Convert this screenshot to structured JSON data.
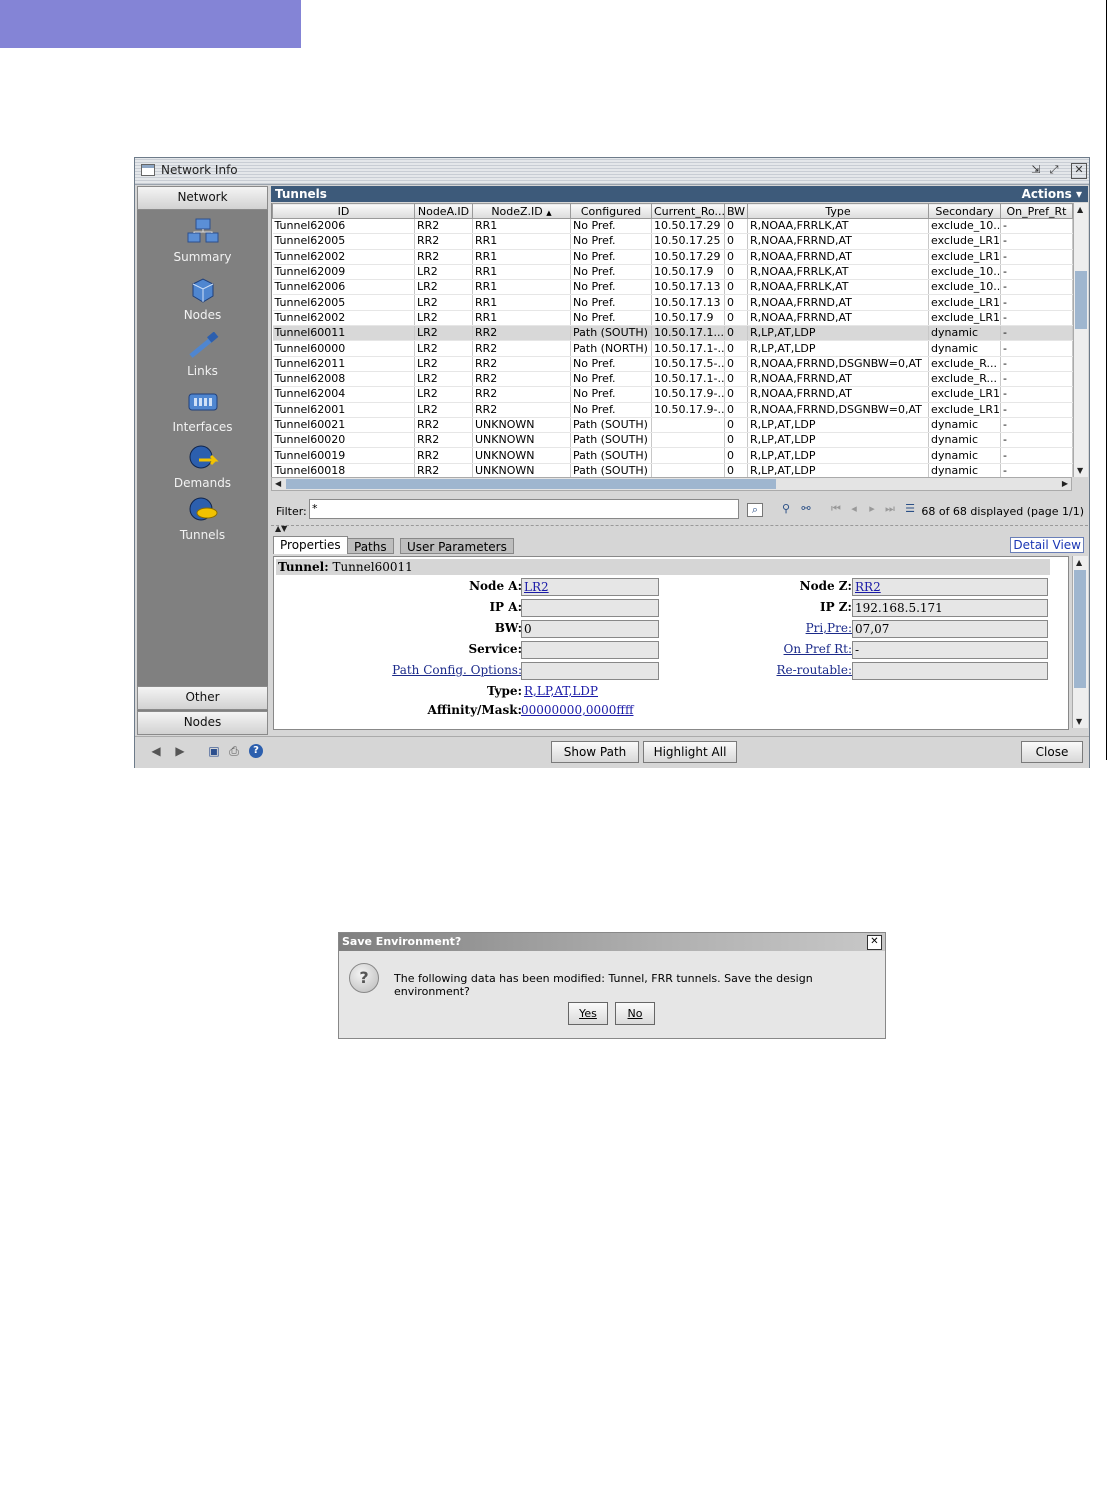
{
  "window": {
    "title": "Network Info"
  },
  "nav": {
    "header": "Network",
    "items": [
      {
        "label": "Summary",
        "icon": "summary-icon"
      },
      {
        "label": "Nodes",
        "icon": "nodes-icon"
      },
      {
        "label": "Links",
        "icon": "links-icon"
      },
      {
        "label": "Interfaces",
        "icon": "interfaces-icon"
      },
      {
        "label": "Demands",
        "icon": "demands-icon"
      },
      {
        "label": "Tunnels",
        "icon": "tunnels-icon"
      }
    ],
    "footer": [
      "Other",
      "Nodes"
    ]
  },
  "table": {
    "title": "Tunnels",
    "actions_label": "Actions",
    "columns": [
      "ID",
      "NodeA.ID",
      "NodeZ.ID",
      "Configured",
      "Current_Ro...",
      "BW",
      "Type",
      "Secondary",
      "On_Pref_Rt"
    ],
    "sort_indicator": "▲",
    "rows": [
      [
        "Tunnel62006",
        "RR2",
        "RR1",
        "No Pref.",
        "10.50.17.29",
        "0",
        "R,NOAA,FRRLK,AT",
        "exclude_10...",
        "-"
      ],
      [
        "Tunnel62005",
        "RR2",
        "RR1",
        "No Pref.",
        "10.50.17.25",
        "0",
        "R,NOAA,FRRND,AT",
        "exclude_LR1",
        "-"
      ],
      [
        "Tunnel62002",
        "RR2",
        "RR1",
        "No Pref.",
        "10.50.17.29",
        "0",
        "R,NOAA,FRRND,AT",
        "exclude_LR1",
        "-"
      ],
      [
        "Tunnel62009",
        "LR2",
        "RR1",
        "No Pref.",
        "10.50.17.9",
        "0",
        "R,NOAA,FRRLK,AT",
        "exclude_10...",
        "-"
      ],
      [
        "Tunnel62006",
        "LR2",
        "RR1",
        "No Pref.",
        "10.50.17.13",
        "0",
        "R,NOAA,FRRLK,AT",
        "exclude_10...",
        "-"
      ],
      [
        "Tunnel62005",
        "LR2",
        "RR1",
        "No Pref.",
        "10.50.17.13",
        "0",
        "R,NOAA,FRRND,AT",
        "exclude_LR1",
        "-"
      ],
      [
        "Tunnel62002",
        "LR2",
        "RR1",
        "No Pref.",
        "10.50.17.9",
        "0",
        "R,NOAA,FRRND,AT",
        "exclude_LR1",
        "-"
      ],
      [
        "Tunnel60011",
        "LR2",
        "RR2",
        "Path (SOUTH)",
        "10.50.17.1...",
        "0",
        "R,LP,AT,LDP",
        "dynamic",
        "-"
      ],
      [
        "Tunnel60000",
        "LR2",
        "RR2",
        "Path (NORTH)",
        "10.50.17.1-...",
        "0",
        "R,LP,AT,LDP",
        "dynamic",
        "-"
      ],
      [
        "Tunnel62011",
        "LR2",
        "RR2",
        "No Pref.",
        "10.50.17.5-...",
        "0",
        "R,NOAA,FRRND,DSGNBW=0,AT",
        "exclude_R...",
        "-"
      ],
      [
        "Tunnel62008",
        "LR2",
        "RR2",
        "No Pref.",
        "10.50.17.1-...",
        "0",
        "R,NOAA,FRRND,AT",
        "exclude_R...",
        "-"
      ],
      [
        "Tunnel62004",
        "LR2",
        "RR2",
        "No Pref.",
        "10.50.17.9-...",
        "0",
        "R,NOAA,FRRND,AT",
        "exclude_LR1",
        "-"
      ],
      [
        "Tunnel62001",
        "LR2",
        "RR2",
        "No Pref.",
        "10.50.17.9-...",
        "0",
        "R,NOAA,FRRND,DSGNBW=0,AT",
        "exclude_LR1",
        "-"
      ],
      [
        "Tunnel60021",
        "RR2",
        "UNKNOWN",
        "Path (SOUTH)",
        "",
        "0",
        "R,LP,AT,LDP",
        "dynamic",
        "-"
      ],
      [
        "Tunnel60020",
        "RR2",
        "UNKNOWN",
        "Path (SOUTH)",
        "",
        "0",
        "R,LP,AT,LDP",
        "dynamic",
        "-"
      ],
      [
        "Tunnel60019",
        "RR2",
        "UNKNOWN",
        "Path (SOUTH)",
        "",
        "0",
        "R,LP,AT,LDP",
        "dynamic",
        "-"
      ],
      [
        "Tunnel60018",
        "RR2",
        "UNKNOWN",
        "Path (SOUTH)",
        "",
        "0",
        "R,LP,AT,LDP",
        "dynamic",
        "-"
      ]
    ],
    "selected_row": 7
  },
  "filter": {
    "label": "Filter:",
    "value": "*",
    "count_text": "68 of 68 displayed (page 1/1)"
  },
  "properties": {
    "tabs": [
      "Properties",
      "Paths",
      "User Parameters"
    ],
    "detail_view": "Detail View",
    "tunnel_label": "Tunnel:",
    "tunnel_value": "Tunnel60011",
    "node_a_label": "Node A:",
    "node_a_value": "LR2",
    "ip_a_label": "IP A:",
    "ip_a_value": "",
    "bw_label": "BW:",
    "bw_value": "0",
    "service_label": "Service:",
    "service_value": "",
    "path_config_label": "Path Config. Options:",
    "path_config_value": "",
    "type_label": "Type:",
    "type_value": "R,LP,AT,LDP",
    "affinity_label": "Affinity/Mask:",
    "affinity_value": "00000000,0000ffff",
    "node_z_label": "Node Z:",
    "node_z_value": "RR2",
    "ip_z_label": "IP Z:",
    "ip_z_value": "192.168.5.171",
    "pri_pre_label": "Pri,Pre:",
    "pri_pre_value": "07,07",
    "on_pref_label": "On Pref Rt:",
    "on_pref_value": "-",
    "reroutable_label": "Re-routable:",
    "reroutable_value": ""
  },
  "bottom": {
    "show_path": "Show Path",
    "highlight_all": "Highlight All",
    "close": "Close"
  },
  "dialog": {
    "title": "Save Environment?",
    "message": "The following data has been modified: Tunnel, FRR tunnels.  Save the design environment?",
    "yes": "Yes",
    "no": "No"
  },
  "colors": {
    "accent_bar": "#8484d6",
    "table_header": "#3d5a7a",
    "nav_background": "#808080",
    "link": "#1a1aa8"
  }
}
